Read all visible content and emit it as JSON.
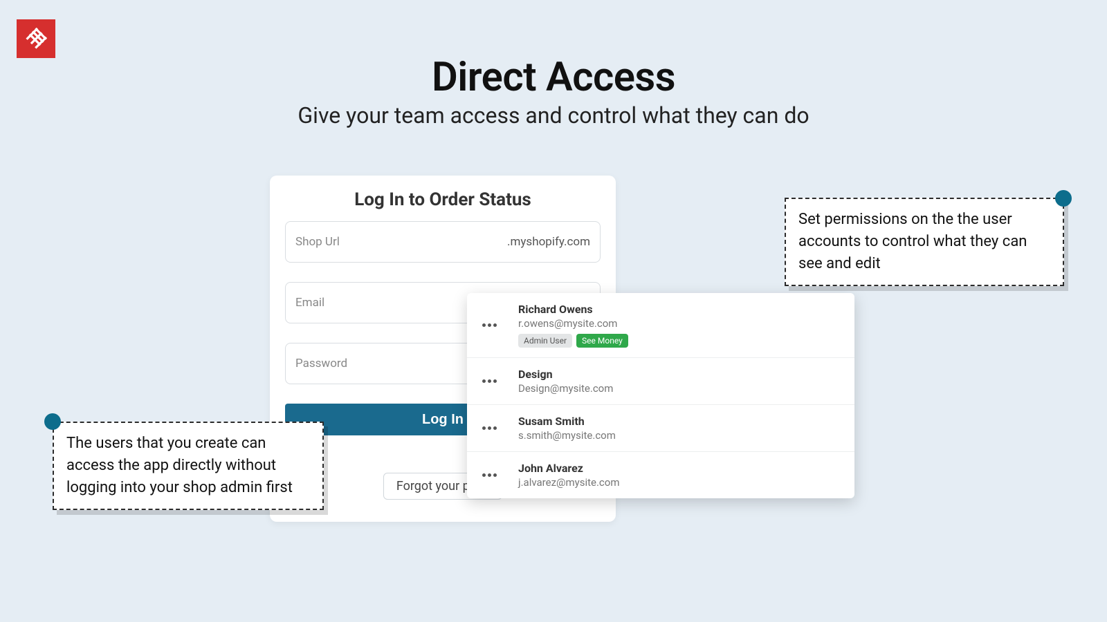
{
  "hero": {
    "title": "Direct Access",
    "subtitle": "Give your team access and control what they can do"
  },
  "login": {
    "title": "Log In to Order Status",
    "shop_url_placeholder": "Shop Url",
    "shop_url_suffix": ".myshopify.com",
    "email_placeholder": "Email",
    "password_placeholder": "Password",
    "submit_label": "Log In",
    "forgot_label": "Forgot your pass"
  },
  "users": [
    {
      "name": "Richard Owens",
      "email": "r.owens@mysite.com",
      "badges": [
        {
          "text": "Admin User",
          "style": "grey"
        },
        {
          "text": "See Money",
          "style": "green"
        }
      ]
    },
    {
      "name": "Design",
      "email": "Design@mysite.com",
      "badges": []
    },
    {
      "name": "Susam Smith",
      "email": "s.smith@mysite.com",
      "badges": []
    },
    {
      "name": "John Alvarez",
      "email": "j.alvarez@mysite.com",
      "badges": []
    }
  ],
  "callouts": {
    "left": "The users that you create can access the app directly without logging into your shop admin first",
    "right": "Set permissions on the the user accounts to control what they can see and edit"
  }
}
